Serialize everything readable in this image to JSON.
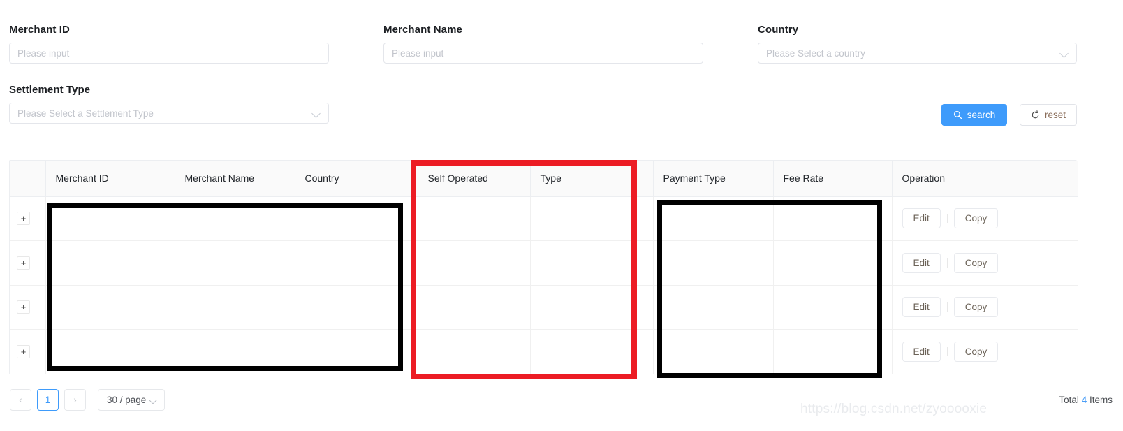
{
  "filters": {
    "merchant_id": {
      "label": "Merchant ID",
      "placeholder": "Please input",
      "value": ""
    },
    "merchant_name": {
      "label": "Merchant Name",
      "placeholder": "Please input",
      "value": ""
    },
    "country": {
      "label": "Country",
      "placeholder": "Please Select a country",
      "value": ""
    },
    "settlement_type": {
      "label": "Settlement Type",
      "placeholder": "Please Select a Settlement Type",
      "value": ""
    }
  },
  "actions": {
    "search_label": "search",
    "search_icon": "search-icon",
    "reset_label": "reset",
    "reset_icon": "reload-icon",
    "primary_color": "#3e9bfb"
  },
  "table": {
    "columns": [
      {
        "key": "expand",
        "label": ""
      },
      {
        "key": "merchant_id",
        "label": "Merchant ID"
      },
      {
        "key": "merchant_name",
        "label": "Merchant Name"
      },
      {
        "key": "country",
        "label": "Country"
      },
      {
        "key": "self_operated",
        "label": "Self Operated"
      },
      {
        "key": "type",
        "label": "Type"
      },
      {
        "key": "payment_type",
        "label": "Payment Type"
      },
      {
        "key": "fee_rate",
        "label": "Fee Rate"
      },
      {
        "key": "operation",
        "label": "Operation"
      }
    ],
    "expand_icon": "+",
    "row_actions": {
      "edit_label": "Edit",
      "copy_label": "Copy"
    },
    "rows": [
      {
        "merchant_id": "",
        "merchant_name": "",
        "country": "",
        "self_operated": "",
        "type": "",
        "payment_type": "",
        "fee_rate": ""
      },
      {
        "merchant_id": "",
        "merchant_name": "",
        "country": "",
        "self_operated": "",
        "type": "",
        "payment_type": "",
        "fee_rate": ""
      },
      {
        "merchant_id": "",
        "merchant_name": "",
        "country": "",
        "self_operated": "",
        "type": "",
        "payment_type": "",
        "fee_rate": ""
      },
      {
        "merchant_id": "",
        "merchant_name": "",
        "country": "",
        "self_operated": "",
        "type": "",
        "payment_type": "",
        "fee_rate": ""
      }
    ]
  },
  "pagination": {
    "prev_icon": "‹",
    "next_icon": "›",
    "current_page": "1",
    "page_size_label": "30 / page",
    "total_prefix": "Total",
    "total_count": "4",
    "total_suffix": "Items"
  },
  "watermark": "https://blog.csdn.net/zyooooxie",
  "annotations": {
    "red_box_color": "#ec1c24",
    "black_box_color": "#000000"
  }
}
